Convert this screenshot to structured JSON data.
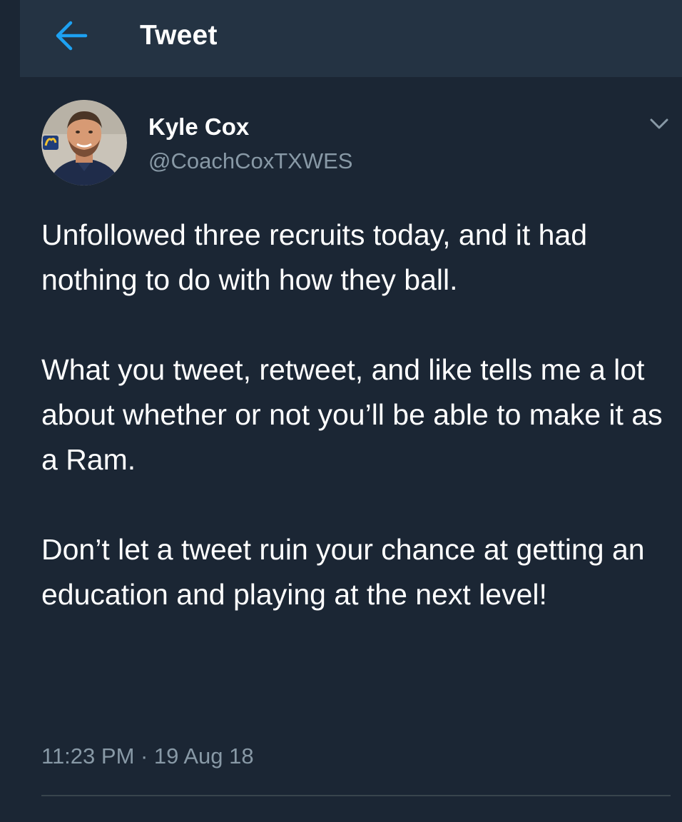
{
  "header": {
    "title": "Tweet",
    "back_icon": "arrow-left-icon"
  },
  "author": {
    "display_name": "Kyle Cox",
    "handle": "@CoachCoxTXWES",
    "avatar_icon": "profile-photo"
  },
  "tweet": {
    "paragraphs": [
      "Unfollowed three recruits today, and it had nothing to do with how they ball.",
      "What you tweet, retweet, and like tells me a lot about whether or not you’ll be able to make it as a Ram.",
      "Don’t let a tweet ruin your chance at getting an education and playing at the next level!"
    ],
    "timestamp": "11:23 PM · 19 Aug 18"
  },
  "menu": {
    "caret_icon": "chevron-down-icon"
  },
  "colors": {
    "background": "#1b2634",
    "header_bar": "#243343",
    "accent_blue": "#1da1f2",
    "text_primary": "#ffffff",
    "text_secondary": "#8899a6",
    "divider": "#38444d"
  }
}
